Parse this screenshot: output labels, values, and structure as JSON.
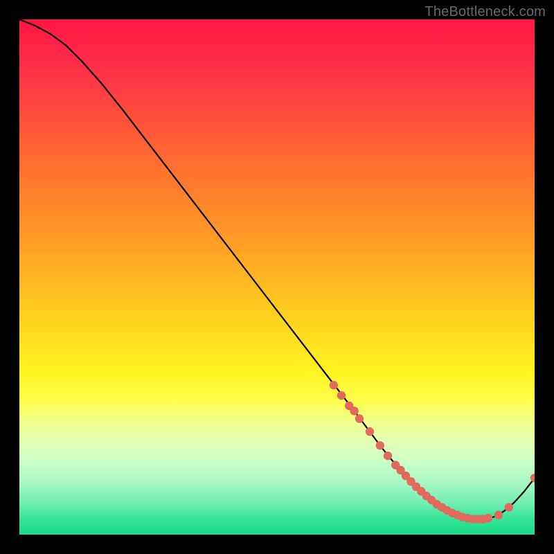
{
  "watermark": "TheBottleneck.com",
  "chart_data": {
    "type": "line",
    "title": "",
    "xlabel": "",
    "ylabel": "",
    "xlim": [
      0,
      100
    ],
    "ylim": [
      0,
      100
    ],
    "grid": false,
    "legend": false,
    "series": [
      {
        "name": "curve",
        "x": [
          0,
          3,
          6,
          9,
          12,
          16,
          20,
          25,
          30,
          35,
          40,
          45,
          50,
          55,
          60,
          65,
          68,
          70,
          72,
          74,
          76,
          78,
          80,
          82,
          84,
          86,
          88,
          90,
          92,
          94,
          96,
          98,
          100
        ],
        "y": [
          100,
          98.8,
          97.2,
          95.0,
          92.0,
          87.5,
          82.5,
          76.0,
          69.5,
          63.0,
          56.5,
          50.0,
          43.5,
          37.0,
          30.5,
          24.0,
          20.0,
          17.3,
          14.8,
          12.5,
          10.3,
          8.4,
          6.7,
          5.3,
          4.2,
          3.4,
          3.0,
          3.0,
          3.4,
          4.5,
          6.2,
          8.4,
          11.0
        ]
      }
    ],
    "markers": {
      "name": "points",
      "color": "#e06a5b",
      "r": 6.2,
      "x": [
        61,
        62.5,
        64,
        65,
        66,
        68,
        70,
        71.5,
        73,
        74,
        75,
        76,
        77,
        78,
        79,
        80,
        81,
        82,
        83,
        84,
        85,
        86,
        87,
        88,
        89,
        90,
        91,
        93,
        95,
        100
      ],
      "y": [
        29.0,
        27.0,
        25.0,
        24.0,
        22.5,
        20.0,
        17.3,
        15.3,
        13.5,
        12.5,
        11.4,
        10.3,
        9.3,
        8.4,
        7.5,
        6.7,
        5.9,
        5.3,
        4.7,
        4.2,
        3.8,
        3.4,
        3.2,
        3.0,
        3.0,
        3.0,
        3.2,
        3.8,
        5.3,
        11.0
      ]
    }
  }
}
